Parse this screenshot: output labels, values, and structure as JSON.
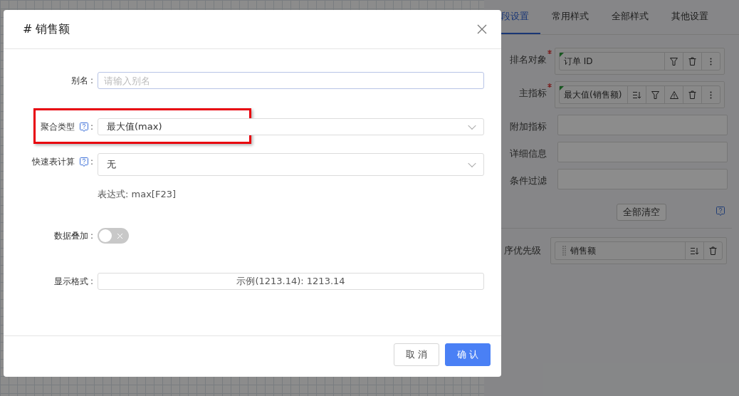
{
  "side_panel": {
    "tabs": [
      {
        "label": "段设置",
        "selected": true
      },
      {
        "label": "常用样式",
        "selected": false
      },
      {
        "label": "全部样式",
        "selected": false
      },
      {
        "label": "其他设置",
        "selected": false
      }
    ],
    "fields": [
      {
        "label": "排名对象",
        "required": true,
        "item": {
          "text": "订单 ID",
          "actions": [
            {
              "kind": "filter"
            },
            {
              "kind": "delete"
            },
            {
              "kind": "more"
            }
          ]
        }
      },
      {
        "label": "主指标",
        "required": true,
        "item": {
          "text": "最大值(销售额)",
          "actions": [
            {
              "kind": "sort"
            },
            {
              "kind": "filter"
            },
            {
              "kind": "warning"
            },
            {
              "kind": "delete"
            },
            {
              "kind": "more"
            }
          ]
        }
      },
      {
        "label": "附加指标",
        "required": false
      },
      {
        "label": "详细信息",
        "required": false
      },
      {
        "label": "条件过滤",
        "required": false
      }
    ],
    "clear_button": "全部清空",
    "sort_priority": {
      "label": "序优先级",
      "item": {
        "text": "销售额",
        "actions": [
          {
            "kind": "sort"
          },
          {
            "kind": "delete"
          }
        ]
      }
    }
  },
  "dialog": {
    "title": "# 销售额",
    "rows": [
      {
        "kind": "input",
        "label": "别名",
        "colon": ":",
        "help": false,
        "highlighted": false,
        "placeholder": "请输入别名"
      },
      {
        "kind": "select",
        "label": "聚合类型",
        "colon": ":",
        "help": true,
        "highlighted": true,
        "value": "最大值(max)"
      },
      {
        "kind": "select",
        "label": "快速表计算",
        "colon": ":",
        "help": true,
        "highlighted": false,
        "value": "无",
        "note": "表达式: max[F23]"
      },
      {
        "kind": "toggle",
        "label": "数据叠加",
        "colon": ":",
        "help": false,
        "highlighted": false,
        "on": false
      },
      {
        "kind": "format",
        "label": "显示格式",
        "colon": ":",
        "help": false,
        "highlighted": false,
        "value": "示例(1213.14): 1213.14"
      }
    ],
    "buttons": [
      {
        "label": "取 消",
        "primary": false
      },
      {
        "label": "确 认",
        "primary": true
      }
    ]
  }
}
